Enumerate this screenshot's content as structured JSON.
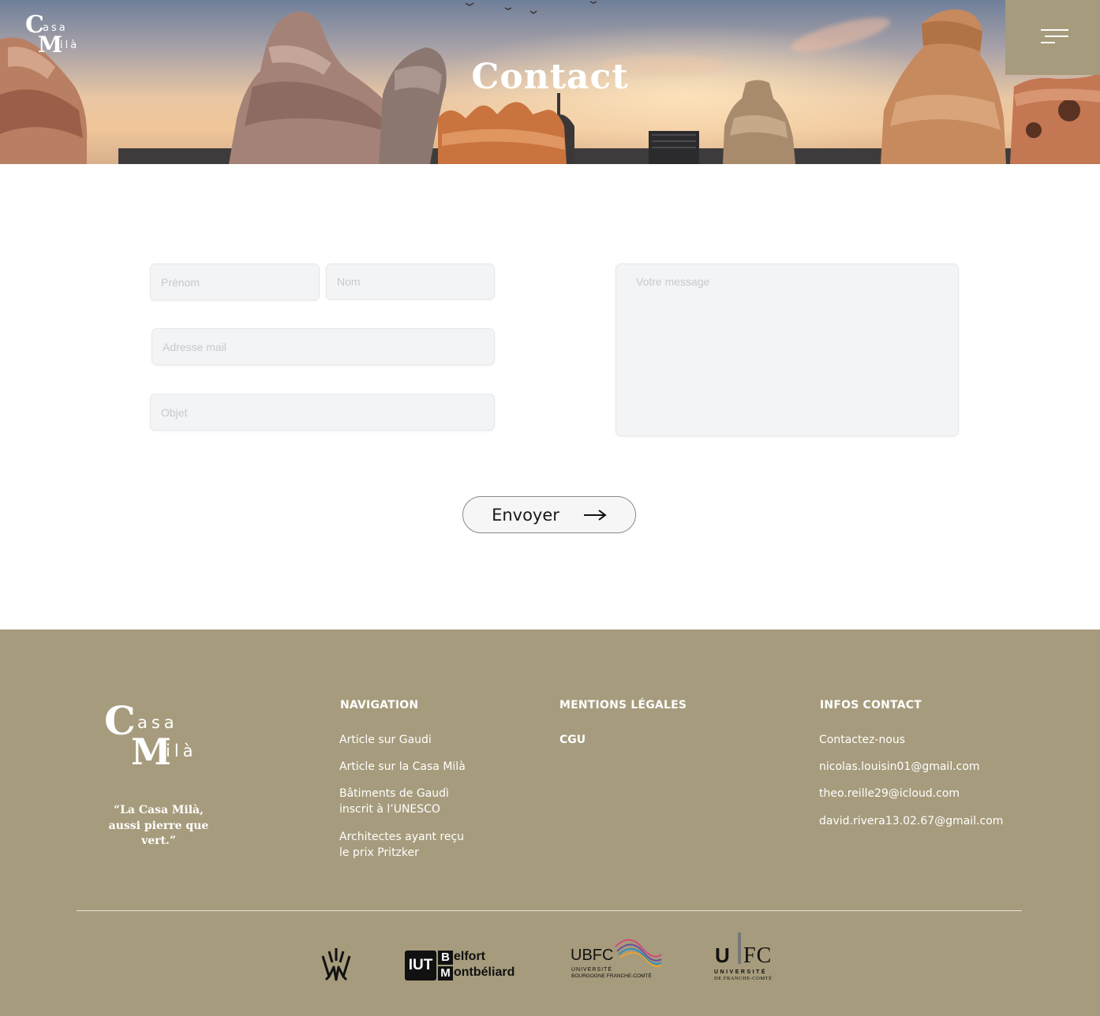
{
  "header": {
    "logo_big_c": "C",
    "logo_big_m": "M",
    "logo_word_top": "asa",
    "logo_word_bottom": "ilà",
    "title": "Contact",
    "menu_icon": "hamburger-menu-icon"
  },
  "form": {
    "first_name_placeholder": "Prénom",
    "last_name_placeholder": "Nom",
    "email_placeholder": "Adresse mail",
    "subject_placeholder": "Objet",
    "message_placeholder": "Votre message",
    "submit_label": "Envoyer",
    "submit_icon": "arrow-right-icon"
  },
  "footer": {
    "logo_big_c": "C",
    "logo_big_m": "M",
    "logo_word_top": "asa",
    "logo_word_bottom": "ilà",
    "quote": "“La Casa Milà, aussi pierre que vert.”",
    "navigation": {
      "heading": "NAVIGATION",
      "links": [
        "Article sur Gaudi",
        "Article sur la Casa Milà",
        "Bâtiments de Gaudì inscrit à l’UNESCO",
        "Architectes ayant reçu le prix Pritzker"
      ]
    },
    "legal": {
      "heading": "MENTIONS LÉGALES",
      "links": [
        "CGU"
      ]
    },
    "contact": {
      "heading": "INFOS CONTACT",
      "links": [
        "Contactez-nous",
        "nicolas.louisin01@gmail.com",
        "theo.reille29@icloud.com",
        "david.rivera13.02.67@gmail.com"
      ]
    },
    "partners": {
      "iut_box": "IUT",
      "iut_b": "B",
      "iut_elfort": "elfort",
      "iut_m": "M",
      "iut_ontbeliard": "ontbéliard",
      "ubfc_main": "UBFC",
      "ubfc_sub1": "UNIVERSITÉ",
      "ubfc_sub2": "BOURGOGNE FRANCHE-COMTÉ",
      "ufc_u": "U",
      "ufc_fc": "FC",
      "ufc_sub1": "UNIVERSITÉ",
      "ufc_sub2": "DE FRANCHE-COMTÉ"
    }
  },
  "colors": {
    "accent": "#a69b7c",
    "field_bg": "#f3f4f6"
  }
}
